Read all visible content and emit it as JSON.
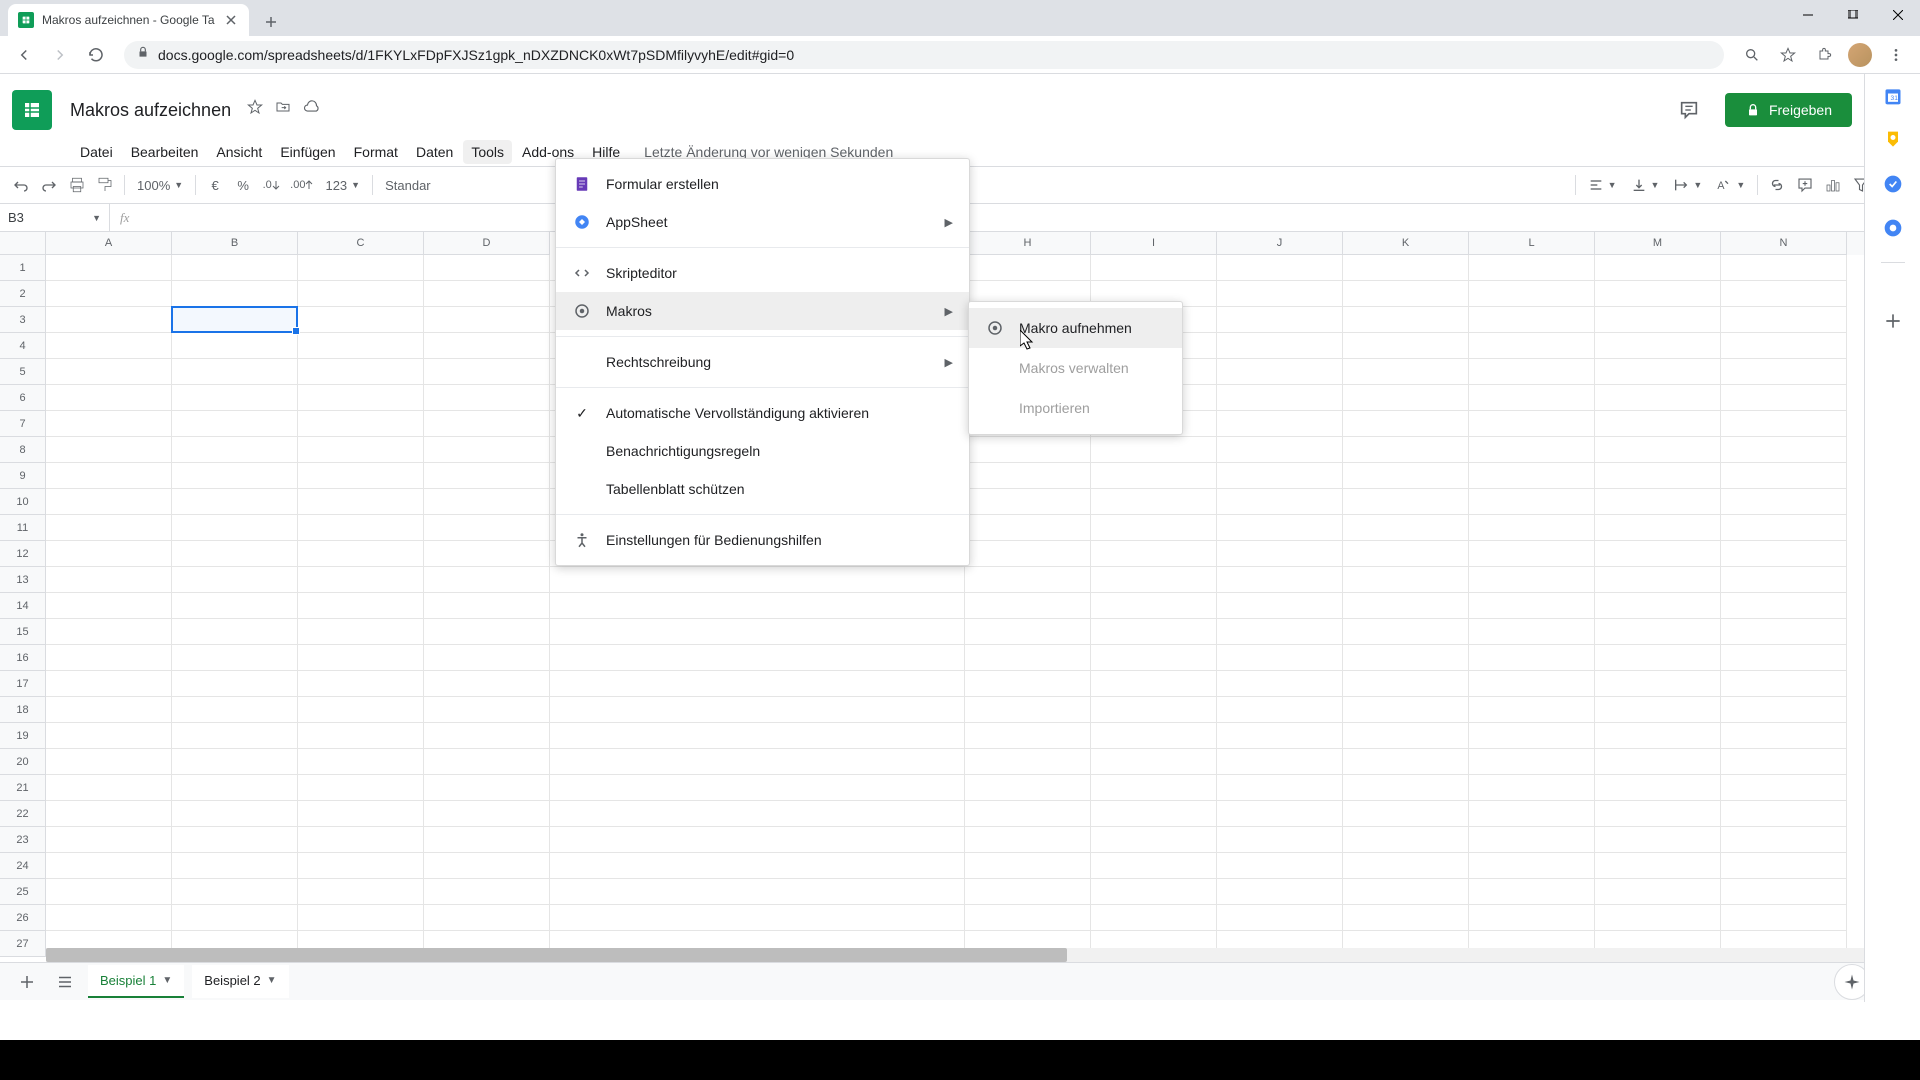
{
  "browser": {
    "tab_title": "Makros aufzeichnen - Google Ta",
    "url": "docs.google.com/spreadsheets/d/1FKYLxFDpFXJSz1gpk_nDXZDNCK0xWt7pSDMfilyvyhE/edit#gid=0"
  },
  "document": {
    "title": "Makros aufzeichnen"
  },
  "menus": {
    "file": "Datei",
    "edit": "Bearbeiten",
    "view": "Ansicht",
    "insert": "Einfügen",
    "format": "Format",
    "data": "Daten",
    "tools": "Tools",
    "addons": "Add-ons",
    "help": "Hilfe",
    "last_edit": "Letzte Änderung vor wenigen Sekunden"
  },
  "share_button": "Freigeben",
  "toolbar": {
    "zoom": "100%",
    "currency": "€",
    "percent": "%",
    "dec_dec": ".0",
    "inc_dec": ".00",
    "more_formats": "123",
    "font": "Standar"
  },
  "name_box": "B3",
  "formula_bar": "",
  "columns": [
    "A",
    "B",
    "C",
    "D",
    "H",
    "I",
    "J",
    "K",
    "L",
    "M",
    "N"
  ],
  "col_widths": {
    "A": 126,
    "B": 126,
    "C": 126,
    "D": 126,
    "H": 126,
    "I": 126,
    "J": 126,
    "K": 126,
    "L": 126,
    "M": 126,
    "N": 126
  },
  "rows": [
    "1",
    "2",
    "3",
    "4",
    "5",
    "6",
    "7",
    "8",
    "9",
    "10",
    "11",
    "12",
    "13",
    "14",
    "15",
    "16",
    "17",
    "18",
    "19",
    "20",
    "21",
    "22",
    "23",
    "24",
    "25",
    "26",
    "27"
  ],
  "selected_cell": {
    "col": "B",
    "row": "3"
  },
  "sheets": {
    "tab1": "Beispiel 1",
    "tab2": "Beispiel 2"
  },
  "tools_menu": {
    "create_form": "Formular erstellen",
    "appsheet": "AppSheet",
    "script_editor": "Skripteditor",
    "macros": "Makros",
    "spelling": "Rechtschreibung",
    "autocomplete": "Automatische Vervollständigung aktivieren",
    "notification_rules": "Benachrichtigungsregeln",
    "protect_sheet": "Tabellenblatt schützen",
    "accessibility": "Einstellungen für Bedienungshilfen"
  },
  "macros_submenu": {
    "record": "Makro aufnehmen",
    "manage": "Makros verwalten",
    "import": "Importieren"
  }
}
